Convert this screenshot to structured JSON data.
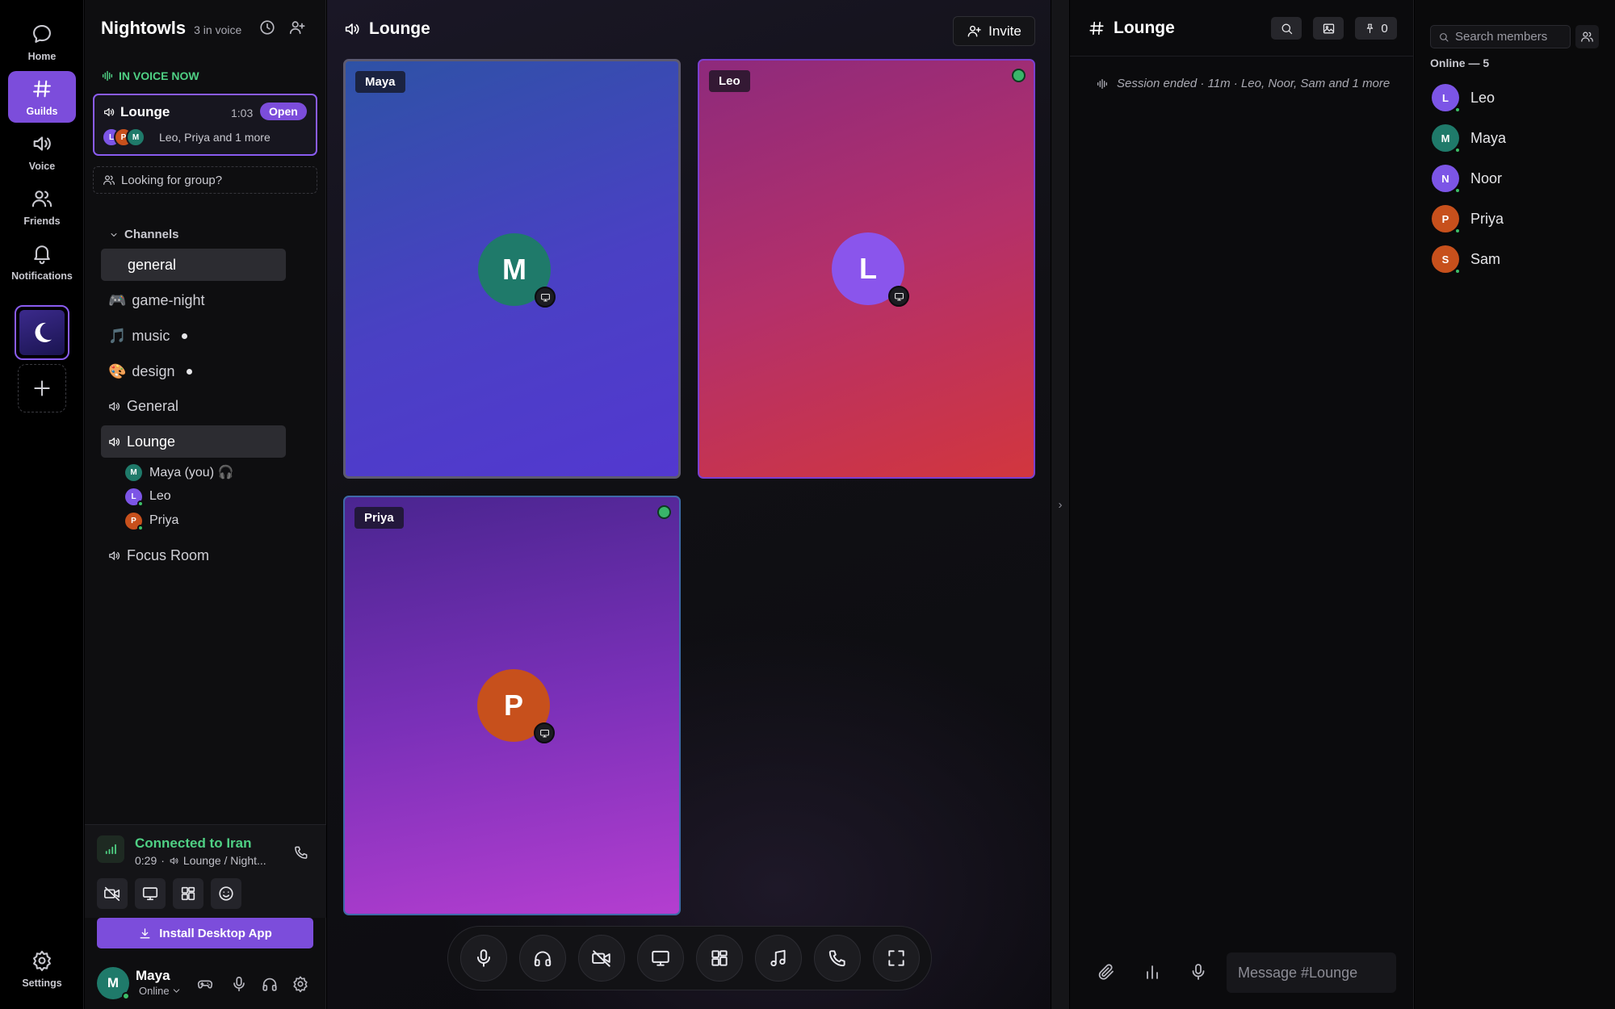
{
  "rail": {
    "items": [
      {
        "label": "Home",
        "icon": "chat-bubble-icon"
      },
      {
        "label": "Guilds",
        "icon": "hash-icon"
      },
      {
        "label": "Voice",
        "icon": "speaker-icon"
      },
      {
        "label": "Friends",
        "icon": "users-icon"
      },
      {
        "label": "Notifications",
        "icon": "bell-icon"
      }
    ],
    "settings_label": "Settings",
    "guild_icon": "moon-icon",
    "add_icon": "plus-icon"
  },
  "sidebar": {
    "guild_name": "Nightowls",
    "voice_count": "3 in voice",
    "in_voice_now": "IN VOICE NOW",
    "voice_card": {
      "channel": "Lounge",
      "time": "1:03",
      "open_label": "Open",
      "avatars": [
        "L",
        "P",
        "M"
      ],
      "members_text": "Leo, Priya and 1 more"
    },
    "lfg_label": "Looking for group?",
    "channels_header": "Channels",
    "channels": [
      {
        "name": "general",
        "prefix": ""
      },
      {
        "name": "game-night",
        "prefix": "🎮"
      },
      {
        "name": "music",
        "prefix": "🎵"
      },
      {
        "name": "design",
        "prefix": "🎨"
      },
      {
        "name": "General",
        "prefix": ""
      },
      {
        "name": "Lounge",
        "prefix": ""
      },
      {
        "name": "Focus Room",
        "prefix": ""
      }
    ],
    "voice_users": [
      {
        "name": "Maya (you) 🎧",
        "initial": "M"
      },
      {
        "name": "Leo",
        "initial": "L"
      },
      {
        "name": "Priya",
        "initial": "P"
      }
    ],
    "connection": {
      "status": "Connected to Iran",
      "time": "0:29",
      "location": "Lounge / Night..."
    },
    "install_label": "Install Desktop App",
    "user": {
      "name": "Maya",
      "initial": "M",
      "status": "Online"
    }
  },
  "main": {
    "title": "Lounge",
    "invite_label": "Invite",
    "tiles": [
      {
        "name": "Maya",
        "initial": "M"
      },
      {
        "name": "Leo",
        "initial": "L"
      },
      {
        "name": "Priya",
        "initial": "P"
      }
    ]
  },
  "chat": {
    "title": "Lounge",
    "pin_count": "0",
    "session_text": "Session ended · 11m · Leo, Noor, Sam and 1 more",
    "message_placeholder": "Message #Lounge"
  },
  "members": {
    "search_placeholder": "Search members",
    "online_header": "Online — 5",
    "list": [
      {
        "name": "Leo",
        "initial": "L",
        "color": "#7c55e6"
      },
      {
        "name": "Maya",
        "initial": "M",
        "color": "#1f7a6a"
      },
      {
        "name": "Noor",
        "initial": "N",
        "color": "#7c55e6"
      },
      {
        "name": "Priya",
        "initial": "P",
        "color": "#c7501c"
      },
      {
        "name": "Sam",
        "initial": "S",
        "color": "#c7501c"
      }
    ]
  },
  "colors": {
    "accent": "#7c4ddb",
    "online": "#3cbf68",
    "voice_green": "#4fd084"
  }
}
